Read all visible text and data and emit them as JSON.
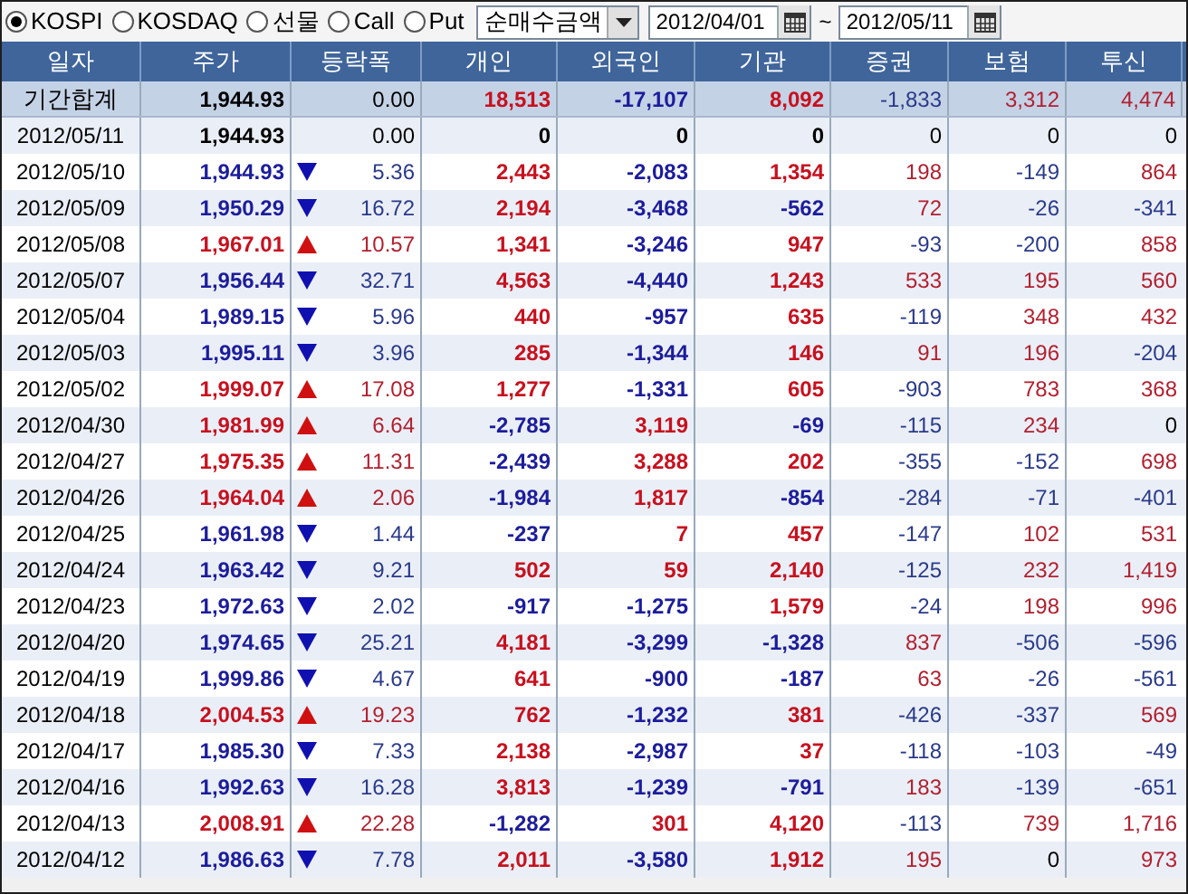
{
  "toolbar": {
    "markets": [
      {
        "label": "KOSPI",
        "selected": true
      },
      {
        "label": "KOSDAQ",
        "selected": false
      },
      {
        "label": "선물",
        "selected": false
      },
      {
        "label": "Call",
        "selected": false
      },
      {
        "label": "Put",
        "selected": false
      }
    ],
    "measure": {
      "value": "순매수금액"
    },
    "date_from": {
      "value": "2012/04/01"
    },
    "range_separator": "~",
    "date_to": {
      "value": "2012/05/11"
    }
  },
  "table": {
    "columns": [
      "일자",
      "주가",
      "등락폭",
      "개인",
      "외국인",
      "기관",
      "증권",
      "보험",
      "투신"
    ],
    "summary": {
      "label": "기간합계",
      "cells": [
        "1,944.93",
        "0.00",
        "18,513",
        "-17,107",
        "8,092",
        "-1,833",
        "3,312",
        "4,474"
      ]
    },
    "rows": [
      {
        "date": "2012/05/11",
        "price": "1,944.93",
        "rising": false,
        "falling": false,
        "change": "0.00",
        "individual": "0",
        "foreign": "0",
        "institution": "0",
        "securities": "0",
        "insurance": "0",
        "trust": "0"
      },
      {
        "date": "2012/05/10",
        "price": "1,944.93",
        "rising": false,
        "falling": true,
        "change": "5.36",
        "individual": "2,443",
        "foreign": "-2,083",
        "institution": "1,354",
        "securities": "198",
        "insurance": "-149",
        "trust": "864"
      },
      {
        "date": "2012/05/09",
        "price": "1,950.29",
        "rising": false,
        "falling": true,
        "change": "16.72",
        "individual": "2,194",
        "foreign": "-3,468",
        "institution": "-562",
        "securities": "72",
        "insurance": "-26",
        "trust": "-341"
      },
      {
        "date": "2012/05/08",
        "price": "1,967.01",
        "rising": true,
        "falling": false,
        "change": "10.57",
        "individual": "1,341",
        "foreign": "-3,246",
        "institution": "947",
        "securities": "-93",
        "insurance": "-200",
        "trust": "858"
      },
      {
        "date": "2012/05/07",
        "price": "1,956.44",
        "rising": false,
        "falling": true,
        "change": "32.71",
        "individual": "4,563",
        "foreign": "-4,440",
        "institution": "1,243",
        "securities": "533",
        "insurance": "195",
        "trust": "560"
      },
      {
        "date": "2012/05/04",
        "price": "1,989.15",
        "rising": false,
        "falling": true,
        "change": "5.96",
        "individual": "440",
        "foreign": "-957",
        "institution": "635",
        "securities": "-119",
        "insurance": "348",
        "trust": "432"
      },
      {
        "date": "2012/05/03",
        "price": "1,995.11",
        "rising": false,
        "falling": true,
        "change": "3.96",
        "individual": "285",
        "foreign": "-1,344",
        "institution": "146",
        "securities": "91",
        "insurance": "196",
        "trust": "-204"
      },
      {
        "date": "2012/05/02",
        "price": "1,999.07",
        "rising": true,
        "falling": false,
        "change": "17.08",
        "individual": "1,277",
        "foreign": "-1,331",
        "institution": "605",
        "securities": "-903",
        "insurance": "783",
        "trust": "368"
      },
      {
        "date": "2012/04/30",
        "price": "1,981.99",
        "rising": true,
        "falling": false,
        "change": "6.64",
        "individual": "-2,785",
        "foreign": "3,119",
        "institution": "-69",
        "securities": "-115",
        "insurance": "234",
        "trust": "0"
      },
      {
        "date": "2012/04/27",
        "price": "1,975.35",
        "rising": true,
        "falling": false,
        "change": "11.31",
        "individual": "-2,439",
        "foreign": "3,288",
        "institution": "202",
        "securities": "-355",
        "insurance": "-152",
        "trust": "698"
      },
      {
        "date": "2012/04/26",
        "price": "1,964.04",
        "rising": true,
        "falling": false,
        "change": "2.06",
        "individual": "-1,984",
        "foreign": "1,817",
        "institution": "-854",
        "securities": "-284",
        "insurance": "-71",
        "trust": "-401"
      },
      {
        "date": "2012/04/25",
        "price": "1,961.98",
        "rising": false,
        "falling": true,
        "change": "1.44",
        "individual": "-237",
        "foreign": "7",
        "institution": "457",
        "securities": "-147",
        "insurance": "102",
        "trust": "531"
      },
      {
        "date": "2012/04/24",
        "price": "1,963.42",
        "rising": false,
        "falling": true,
        "change": "9.21",
        "individual": "502",
        "foreign": "59",
        "institution": "2,140",
        "securities": "-125",
        "insurance": "232",
        "trust": "1,419"
      },
      {
        "date": "2012/04/23",
        "price": "1,972.63",
        "rising": false,
        "falling": true,
        "change": "2.02",
        "individual": "-917",
        "foreign": "-1,275",
        "institution": "1,579",
        "securities": "-24",
        "insurance": "198",
        "trust": "996"
      },
      {
        "date": "2012/04/20",
        "price": "1,974.65",
        "rising": false,
        "falling": true,
        "change": "25.21",
        "individual": "4,181",
        "foreign": "-3,299",
        "institution": "-1,328",
        "securities": "837",
        "insurance": "-506",
        "trust": "-596"
      },
      {
        "date": "2012/04/19",
        "price": "1,999.86",
        "rising": false,
        "falling": true,
        "change": "4.67",
        "individual": "641",
        "foreign": "-900",
        "institution": "-187",
        "securities": "63",
        "insurance": "-26",
        "trust": "-561"
      },
      {
        "date": "2012/04/18",
        "price": "2,004.53",
        "rising": true,
        "falling": false,
        "change": "19.23",
        "individual": "762",
        "foreign": "-1,232",
        "institution": "381",
        "securities": "-426",
        "insurance": "-337",
        "trust": "569"
      },
      {
        "date": "2012/04/17",
        "price": "1,985.30",
        "rising": false,
        "falling": true,
        "change": "7.33",
        "individual": "2,138",
        "foreign": "-2,987",
        "institution": "37",
        "securities": "-118",
        "insurance": "-103",
        "trust": "-49"
      },
      {
        "date": "2012/04/16",
        "price": "1,992.63",
        "rising": false,
        "falling": true,
        "change": "16.28",
        "individual": "3,813",
        "foreign": "-1,239",
        "institution": "-791",
        "securities": "183",
        "insurance": "-139",
        "trust": "-651"
      },
      {
        "date": "2012/04/13",
        "price": "2,008.91",
        "rising": true,
        "falling": false,
        "change": "22.28",
        "individual": "-1,282",
        "foreign": "301",
        "institution": "4,120",
        "securities": "-113",
        "insurance": "739",
        "trust": "1,716"
      },
      {
        "date": "2012/04/12",
        "price": "1,986.63",
        "rising": false,
        "falling": true,
        "change": "7.78",
        "individual": "2,011",
        "foreign": "-3,580",
        "institution": "1,912",
        "securities": "195",
        "insurance": "0",
        "trust": "973"
      }
    ]
  }
}
